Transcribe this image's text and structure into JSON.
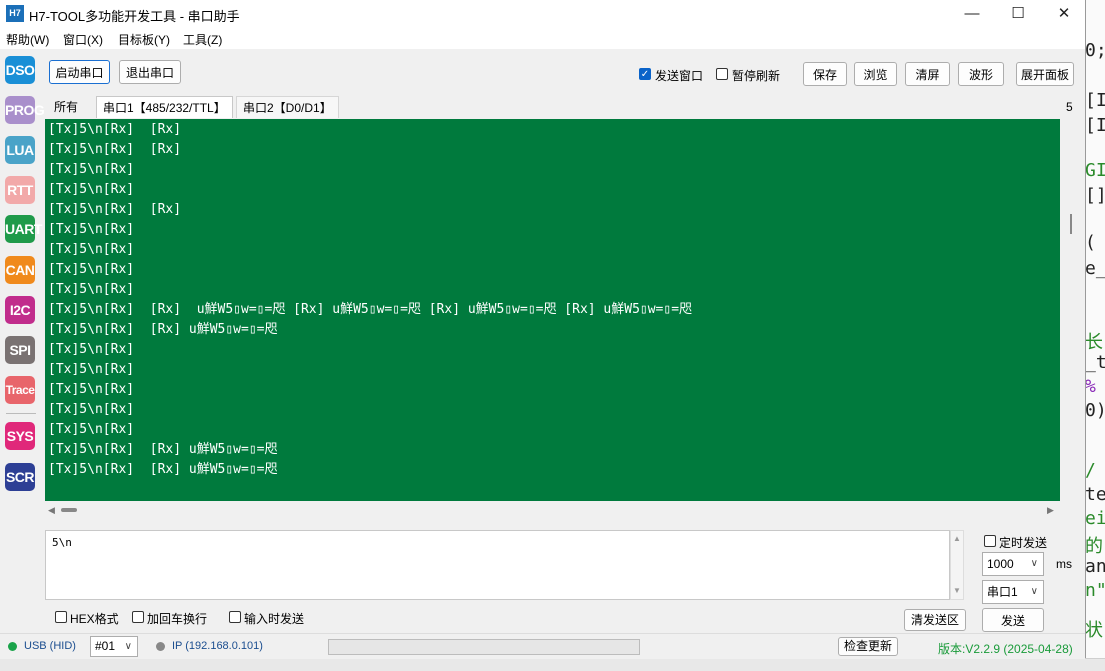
{
  "window": {
    "title": "H7-TOOL多功能开发工具 - 串口助手",
    "icon_label": "H7"
  },
  "menu": [
    "帮助(W)",
    "窗口(X)",
    "目标板(Y)",
    "工具(Z)"
  ],
  "sidebar": [
    {
      "label": "DSO",
      "color": "#1a8fd6"
    },
    {
      "label": "PROG",
      "color": "#a98fcb"
    },
    {
      "label": "LUA",
      "color": "#4aa3c8"
    },
    {
      "label": "RTT",
      "color": "#f2a9a9"
    },
    {
      "label": "UART",
      "color": "#1f9a4a"
    },
    {
      "label": "CAN",
      "color": "#f08a1c"
    },
    {
      "label": "I2C",
      "color": "#c12d8c"
    },
    {
      "label": "SPI",
      "color": "#7a7272"
    },
    {
      "label": "Trace",
      "color": "#e8656b"
    },
    {
      "label": "SYS",
      "color": "#e0287a"
    },
    {
      "label": "SCR",
      "color": "#2d3f95"
    }
  ],
  "toolbar": {
    "open_port": "启动串口",
    "close_port": "退出串口",
    "send_window_label": "发送窗口",
    "send_window_checked": true,
    "pause_refresh_label": "暂停刷新",
    "pause_refresh_checked": false,
    "save": "保存",
    "browse": "浏览",
    "clear": "清屏",
    "waveform": "波形",
    "expand_panel": "展开面板"
  },
  "tabs": [
    "所有",
    "串口1【485/232/TTL】",
    "串口2【D0/D1】"
  ],
  "log_lines": [
    "[Tx]5\\n[Rx]  [Rx]",
    "[Tx]5\\n[Rx]  [Rx]",
    "[Tx]5\\n[Rx]",
    "[Tx]5\\n[Rx]",
    "[Tx]5\\n[Rx]  [Rx]",
    "[Tx]5\\n[Rx]",
    "[Tx]5\\n[Rx]",
    "[Tx]5\\n[Rx]",
    "[Tx]5\\n[Rx]",
    "[Tx]5\\n[Rx]  [Rx]  u鮮W5▯w=▯=咫 [Rx] u鮮W5▯w=▯=咫 [Rx] u鮮W5▯w=▯=咫 [Rx] u鮮W5▯w=▯=咫",
    "[Tx]5\\n[Rx]  [Rx] u鮮W5▯w=▯=咫",
    "[Tx]5\\n[Rx]",
    "[Tx]5\\n[Rx]",
    "[Tx]5\\n[Rx]",
    "[Tx]5\\n[Rx]",
    "[Tx]5\\n[Rx]",
    "[Tx]5\\n[Rx]  [Rx] u鮮W5▯w=▯=咫",
    "[Tx]5\\n[Rx]  [Rx] u鮮W5▯w=▯=咫"
  ],
  "send": {
    "text": "5\\n",
    "timed_send_label": "定时发送",
    "timed_send_checked": false,
    "interval_value": "1000",
    "interval_unit": "ms",
    "port_value": "串口1",
    "hex_label": "HEX格式",
    "crlf_label": "加回车换行",
    "send_on_input_label": "输入时发送",
    "clear_send_label": "清发送区",
    "send_label": "发送"
  },
  "status": {
    "usb": "USB (HID)",
    "usb_color": "#1aa34a",
    "device_no": "#01",
    "ip": "IP (192.168.0.101)",
    "check_update": "检查更新",
    "version": "版本:V2.2.9 (2025-04-28)",
    "version_color": "#1a9b3a"
  },
  "right_edge_count": "5",
  "background_editor": [
    "0;",
    "[In",
    "[In",
    "GI",
    "[]",
    "(",
    "e_",
    "长-",
    "_t",
    "%",
    "0)",
    "/",
    "te",
    "ei",
    "的",
    "an",
    "n\"",
    "状"
  ],
  "colors": {
    "log_bg": "#007a3d",
    "log_text": "#ffffff"
  }
}
